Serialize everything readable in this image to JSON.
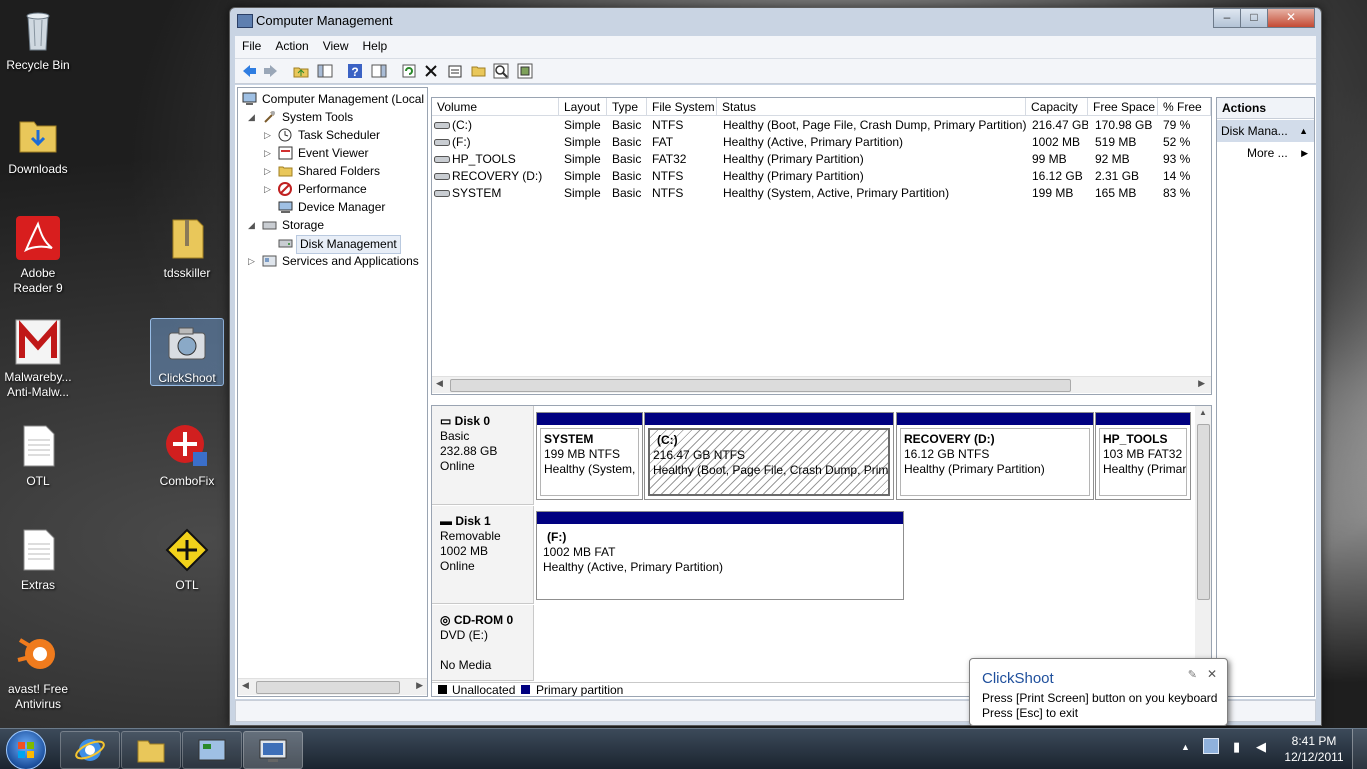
{
  "desktop": {
    "icons": [
      {
        "label": "Recycle Bin"
      },
      {
        "label": "Downloads"
      },
      {
        "label": "Adobe Reader 9"
      },
      {
        "label": "tdsskiller"
      },
      {
        "label": "Malwareby... Anti-Malw..."
      },
      {
        "label": "ClickShoot"
      },
      {
        "label": "OTL"
      },
      {
        "label": "ComboFix"
      },
      {
        "label": "Extras"
      },
      {
        "label": "OTL"
      },
      {
        "label": "avast! Free Antivirus"
      }
    ]
  },
  "window": {
    "title": "Computer Management",
    "controls": {
      "minimize": "–",
      "maximize": "□",
      "close": "✕"
    },
    "menu": [
      "File",
      "Action",
      "View",
      "Help"
    ],
    "tree": {
      "root": "Computer Management (Local",
      "system_tools": "System Tools",
      "task_scheduler": "Task Scheduler",
      "event_viewer": "Event Viewer",
      "shared_folders": "Shared Folders",
      "performance": "Performance",
      "device_manager": "Device Manager",
      "storage": "Storage",
      "disk_management": "Disk Management",
      "services": "Services and Applications"
    },
    "volumes": {
      "headers": [
        "Volume",
        "Layout",
        "Type",
        "File System",
        "Status",
        "Capacity",
        "Free Space",
        "% Free"
      ],
      "rows": [
        [
          "(C:)",
          "Simple",
          "Basic",
          "NTFS",
          "Healthy (Boot, Page File, Crash Dump, Primary Partition)",
          "216.47 GB",
          "170.98 GB",
          "79 %"
        ],
        [
          "(F:)",
          "Simple",
          "Basic",
          "FAT",
          "Healthy (Active, Primary Partition)",
          "1002 MB",
          "519 MB",
          "52 %"
        ],
        [
          "HP_TOOLS",
          "Simple",
          "Basic",
          "FAT32",
          "Healthy (Primary Partition)",
          "99 MB",
          "92 MB",
          "93 %"
        ],
        [
          "RECOVERY (D:)",
          "Simple",
          "Basic",
          "NTFS",
          "Healthy (Primary Partition)",
          "16.12 GB",
          "2.31 GB",
          "14 %"
        ],
        [
          "SYSTEM",
          "Simple",
          "Basic",
          "NTFS",
          "Healthy (System, Active, Primary Partition)",
          "199 MB",
          "165 MB",
          "83 %"
        ]
      ]
    },
    "disks": {
      "disk0": {
        "name": "Disk 0",
        "type": "Basic",
        "size": "232.88 GB",
        "status": "Online"
      },
      "disk0_parts": [
        {
          "name": "SYSTEM",
          "size": "199 MB NTFS",
          "status": "Healthy (System,"
        },
        {
          "name": "(C:)",
          "size": "216.47 GB NTFS",
          "status": "Healthy (Boot, Page File, Crash Dump, Prima"
        },
        {
          "name": "RECOVERY  (D:)",
          "size": "16.12 GB NTFS",
          "status": "Healthy (Primary Partition)"
        },
        {
          "name": "HP_TOOLS",
          "size": "103 MB FAT32",
          "status": "Healthy (Primar"
        }
      ],
      "disk1": {
        "name": "Disk 1",
        "type": "Removable",
        "size": "1002 MB",
        "status": "Online"
      },
      "disk1_part": {
        "name": "(F:)",
        "size": "1002 MB FAT",
        "status": "Healthy (Active, Primary Partition)"
      },
      "cdrom": {
        "name": "CD-ROM 0",
        "type": "DVD (E:)",
        "status": "No Media"
      },
      "legend": {
        "unallocated": "Unallocated",
        "primary": "Primary partition"
      }
    },
    "actions": {
      "header": "Actions",
      "section": "Disk Mana...",
      "more": "More ..."
    }
  },
  "balloon": {
    "title": "ClickShoot",
    "line1": "Press [Print Screen] button on you keyboard",
    "line2": "Press [Esc] to exit"
  },
  "taskbar": {
    "clock_time": "8:41 PM",
    "clock_date": "12/12/2011"
  },
  "colors": {
    "partition_bar": "#000080",
    "title_bar": "#c9d4e3",
    "selection": "#d2dcea"
  }
}
